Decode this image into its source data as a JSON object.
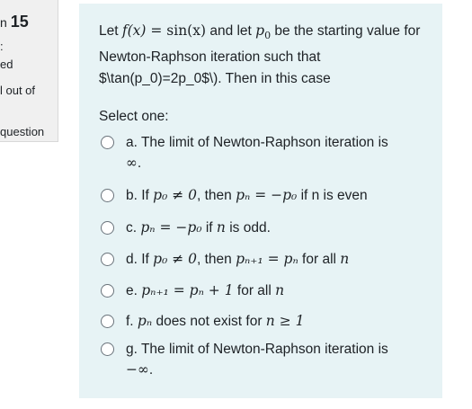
{
  "info": {
    "question_prefix": "n",
    "question_number": "15",
    "status_fragment": "ed",
    "marks_fragment": "l out of",
    "flag_fragment": "question"
  },
  "question": {
    "intro_1": "Let ",
    "f_of_x": "f(x)",
    "eq_sin": " = sin(x)",
    "intro_2": " and let ",
    "p0": "p",
    "p0_sub": "0",
    "intro_3": " be the starting value for Newton-Raphson iteration such that $\\tan(p_0)=2p_0$\\). Then in this case"
  },
  "select_label": "Select one:",
  "options": {
    "a": {
      "prefix": "a. The limit of Newton-Raphson iteration is",
      "math": "∞",
      "suffix": "."
    },
    "b": {
      "prefix": "b. If ",
      "cond": "p₀ ≠ 0",
      "middle": ", then ",
      "expr": "pₙ = −p₀",
      "suffix": " if n is even"
    },
    "c": {
      "prefix": "c. ",
      "expr": "pₙ = −p₀",
      "middle": " if ",
      "var": "n",
      "suffix": " is odd."
    },
    "d": {
      "prefix": "d. If ",
      "cond": "p₀ ≠ 0",
      "middle": ", then ",
      "expr": "pₙ₊₁ = pₙ",
      "suffix": " for all ",
      "var": "n"
    },
    "e": {
      "prefix": "e. ",
      "expr": "pₙ₊₁ = pₙ + 1",
      "suffix": " for all ",
      "var": "n"
    },
    "f": {
      "prefix": "f. ",
      "expr": "pₙ",
      "middle": " does not exist for ",
      "cond": "n ≥ 1"
    },
    "g": {
      "prefix": "g. The limit of Newton-Raphson iteration is",
      "math": "−∞",
      "suffix": "."
    }
  },
  "colors": {
    "question_bg": "#e7f3f5",
    "info_bg": "#f0f0f0",
    "text": "#1d2125"
  }
}
